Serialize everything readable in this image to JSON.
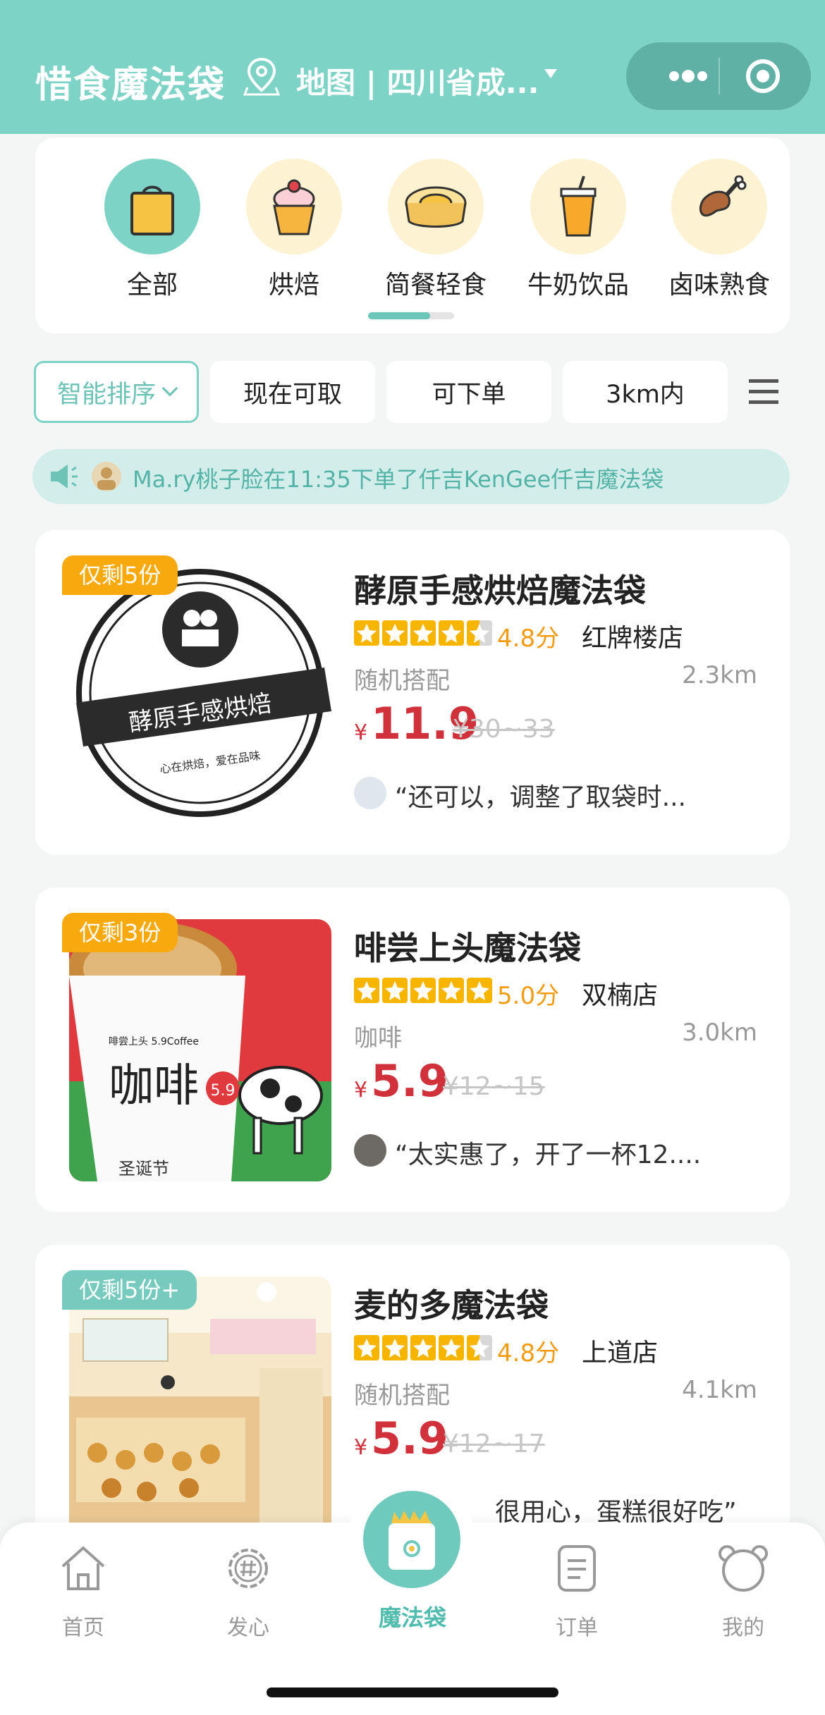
{
  "header": {
    "title": "惜食魔法袋",
    "location": "地图 | 四川省成...",
    "more_icon": "more-dots-icon",
    "close_icon": "target-icon",
    "bg_color": "#7dd3c6"
  },
  "categories": [
    {
      "label": "全部",
      "icon": "shopping-bag-icon",
      "active": true
    },
    {
      "label": "烘焙",
      "icon": "cupcake-icon"
    },
    {
      "label": "简餐轻食",
      "icon": "dumpling-steamer-icon"
    },
    {
      "label": "牛奶饮品",
      "icon": "drink-cup-icon"
    },
    {
      "label": "卤味熟食",
      "icon": "chicken-leg-icon"
    }
  ],
  "filters": {
    "sort": "智能排序",
    "now": "现在可取",
    "orderable": "可下单",
    "distance": "3km内"
  },
  "notice": {
    "text": "Ma.ry桃子脸在11:35下单了仟吉KenGee仟吉魔法袋"
  },
  "stores": [
    {
      "badge": "仅剩5份",
      "name": "酵原手感烘焙魔法袋",
      "stars": 4.5,
      "score": "4.8分",
      "branch": "红牌楼店",
      "type": "随机搭配",
      "distance": "2.3km",
      "currency": "¥",
      "price": "11.9",
      "original": "¥30~33",
      "review": "“还可以，调整了取袋时...",
      "logo_text": "酵原手感烘焙",
      "logo_sub": "心在烘焙，爱在品味"
    },
    {
      "badge": "仅剩3份",
      "name": "啡尝上头魔法袋",
      "stars": 5,
      "score": "5.0分",
      "branch": "双楠店",
      "type": "咖啡",
      "distance": "3.0km",
      "currency": "¥",
      "price": "5.9",
      "original": "¥12~15",
      "review": "“太实惠了，开了一杯12....",
      "cup_text": "咖啡",
      "cup_badge": "5.9",
      "cup_top": "啡尝上头 5.9Coffee",
      "event_text": "圣诞节"
    },
    {
      "badge": "仅剩5份+",
      "name": "麦的多魔法袋",
      "stars": 4.5,
      "score": "4.8分",
      "branch": "上道店",
      "type": "随机搭配",
      "distance": "4.1km",
      "currency": "¥",
      "price": "5.9",
      "original": "¥12~17",
      "review": "很用心，蛋糕很好吃”"
    }
  ],
  "tabbar": {
    "home": "首页",
    "heart": "发心",
    "magic": "魔法袋",
    "orders": "订单",
    "mine": "我的"
  }
}
